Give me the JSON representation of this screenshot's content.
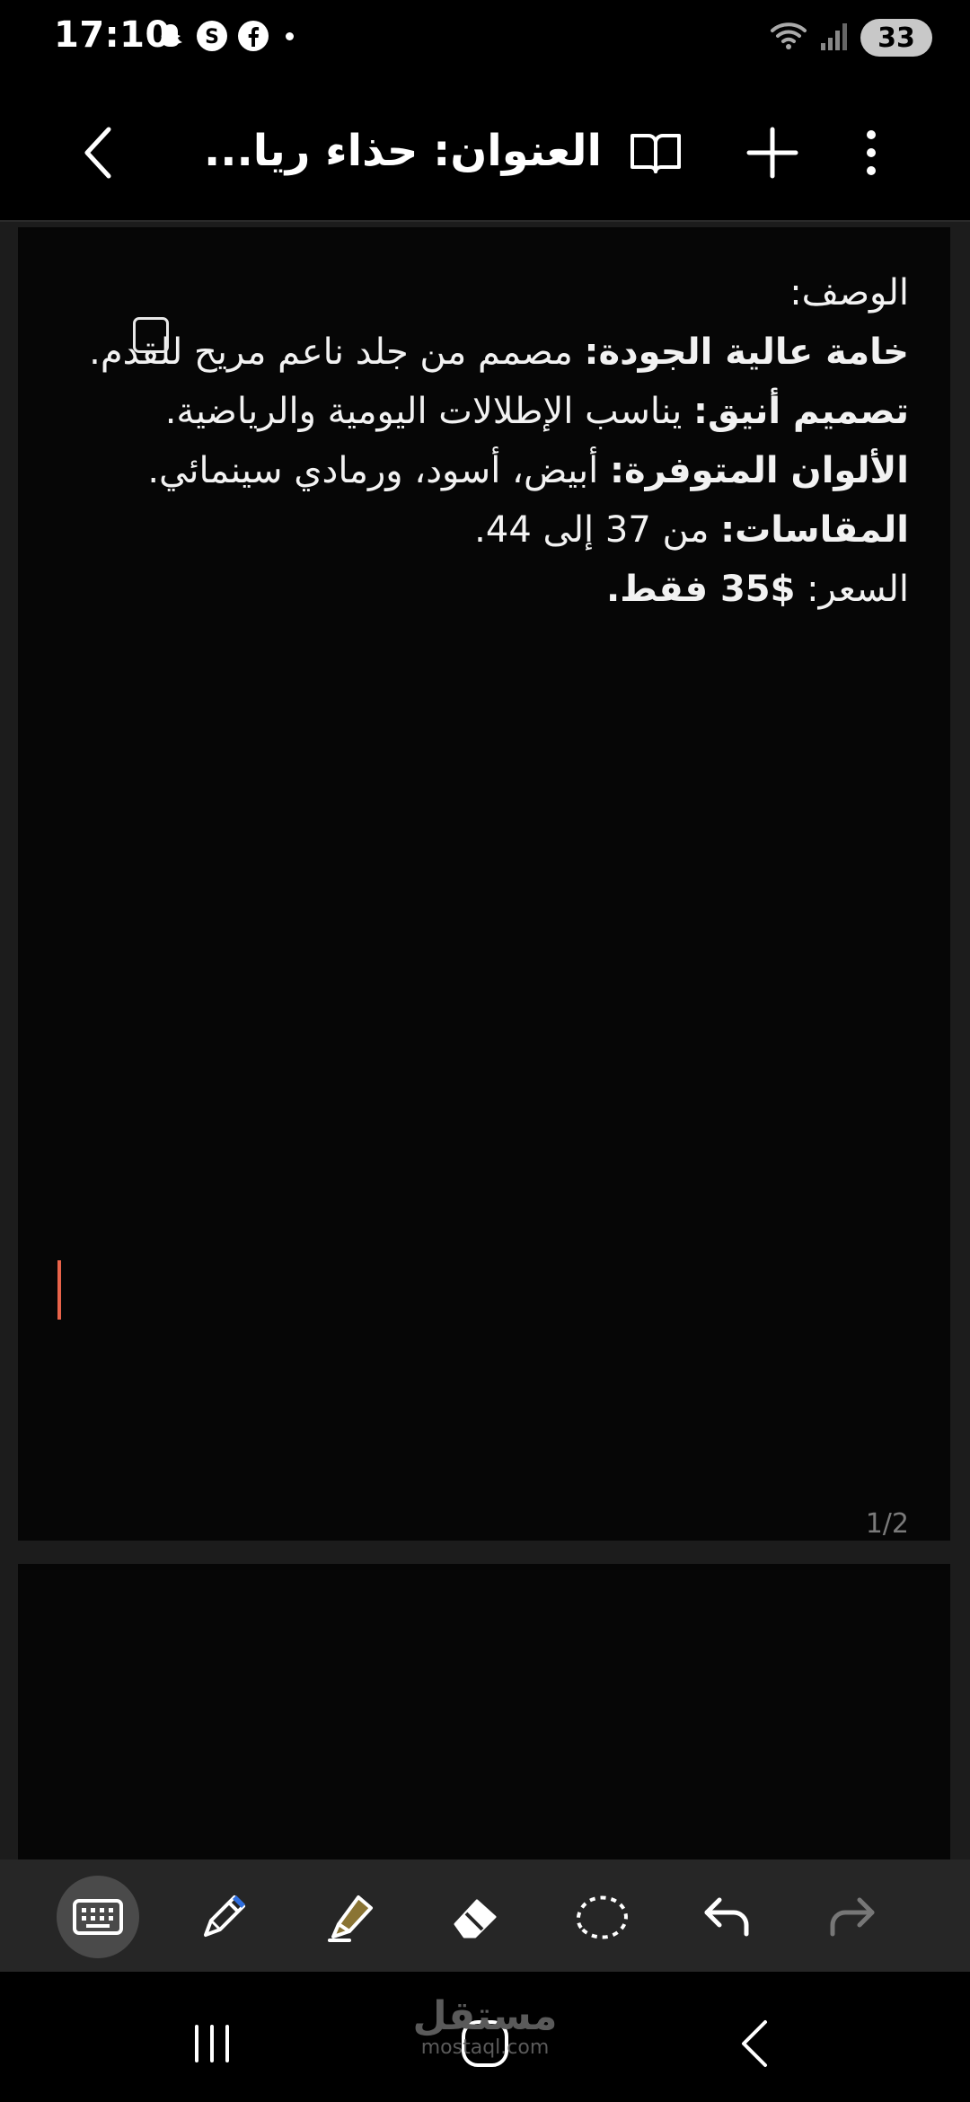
{
  "status_bar": {
    "time": "17:10",
    "notification_icons": [
      "snapchat-icon",
      "threads-icon",
      "facebook-icon"
    ],
    "battery": "33"
  },
  "header": {
    "title": "العنوان: حذاء ريا...",
    "icons": [
      "back-icon",
      "book-icon",
      "add-icon",
      "more-icon"
    ]
  },
  "note": {
    "description_label": "الوصف:",
    "quality_label": "خامة عالية الجودة:",
    "quality_text": " مصمم من جلد ناعم مريح للقدم.",
    "design_label": "تصميم أنيق:",
    "design_text": " يناسب الإطلالات اليومية والرياضية.",
    "colors_label": "الألوان المتوفرة:",
    "colors_text": " أبيض، أسود، ورمادي سينمائي.",
    "sizes_label": "المقاسات:",
    "sizes_text": " من 37 إلى 44.",
    "price_label": "السعر: ",
    "price_value": "$35 فقط.",
    "checkbox_checked": false,
    "page_indicator": "1/2"
  },
  "toolbar": {
    "tools": [
      "keyboard-icon",
      "pen-icon",
      "highlighter-icon",
      "eraser-icon",
      "lasso-icon",
      "undo-icon",
      "redo-icon"
    ],
    "selected_tool": "keyboard-icon",
    "pen_color": "#2f6fe0",
    "highlighter_color": "#8a7434"
  },
  "watermark": {
    "arabic": "مستقل",
    "latin": "mostaql.com"
  },
  "colors": {
    "cursor": "#e8634a",
    "background": "#000000",
    "canvas": "#1c1c1c"
  }
}
